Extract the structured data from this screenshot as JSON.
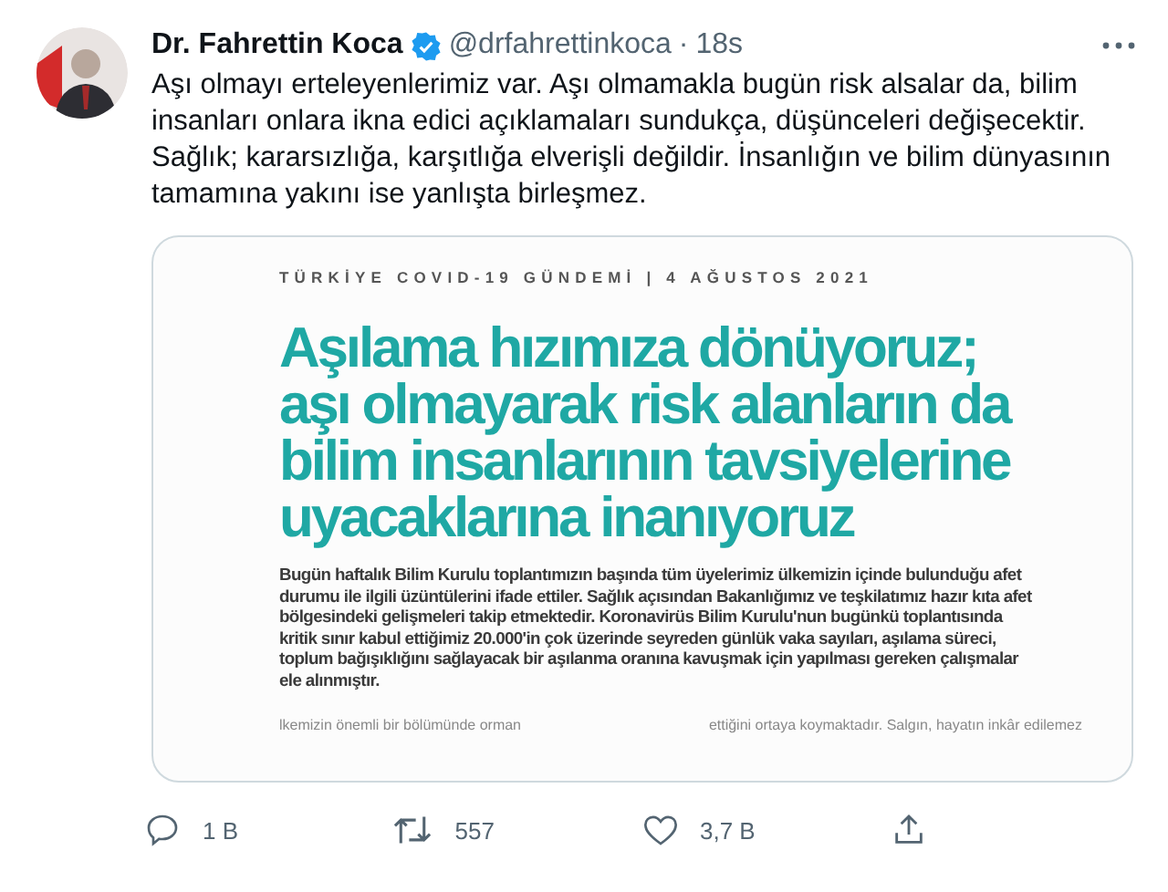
{
  "tweet": {
    "author": {
      "name": "Dr. Fahrettin Koca",
      "verified": true,
      "handle": "@drfahrettinkoca",
      "separator": "·",
      "time": "18s"
    },
    "text": "Aşı olmayı erteleyenlerimiz var. Aşı olmamakla bugün risk alsalar da, bilim insanları onlara ikna edici açıklamaları sundukça, düşünceleri değişecektir. Sağlık; kararsızlığa, karşıtlığa elverişli değildir. İnsanlığın ve bilim dünyasının tamamına yakını ise yanlışta birleşmez.",
    "attachment": {
      "header": "TÜRKİYE COVID-19 GÜNDEMİ | 4 AĞUSTOS 2021",
      "headline": [
        "Aşılama hızımıza dönüyoruz;",
        "aşı olmayarak risk alanların da",
        "bilim insanlarının tavsiyelerine",
        "uyacaklarına inanıyoruz"
      ],
      "body": "Bugün haftalık Bilim Kurulu toplantımızın başında tüm üyelerimiz ülkemizin içinde bulunduğu afet durumu ile ilgili üzüntülerini ifade ettiler. Sağlık açısından Bakanlığımız ve teşkilatımız hazır kıta afet bölgesindeki gelişmeleri takip etmektedir. Koronavirüs Bilim Kurulu'nun bugünkü toplantısında kritik sınır kabul ettiğimiz 20.000'in çok üzerinde seyreden günlük vaka sayıları, aşılama süreci, toplum bağışıklığını sağlayacak bir aşılanma oranına kavuşmak için yapılması gereken çalışmalar ele alınmıştır.",
      "columns": [
        "lkemizin önemli bir bölümünde orman",
        "ettiğini ortaya koymaktadır. Salgın, hayatın inkâr edilemez"
      ]
    },
    "actions": [
      {
        "kind": "reply",
        "count": "1 B"
      },
      {
        "kind": "retweet",
        "count": "557"
      },
      {
        "kind": "like",
        "count": "3,7 B"
      },
      {
        "kind": "share"
      }
    ]
  }
}
